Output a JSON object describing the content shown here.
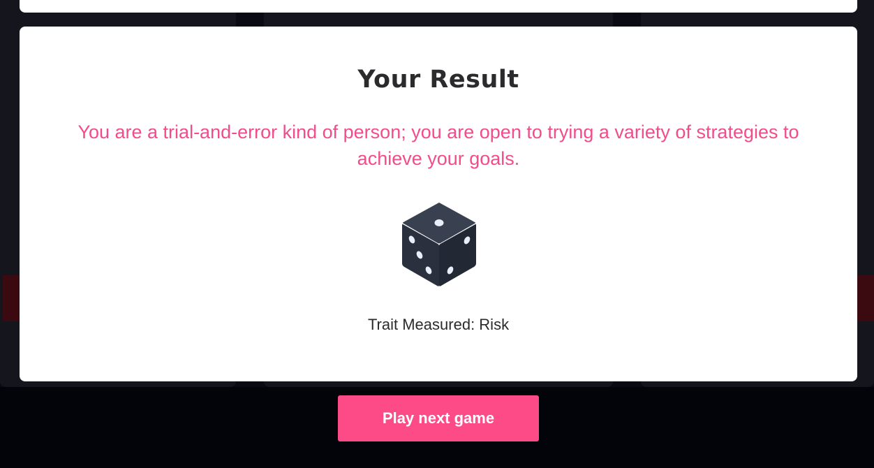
{
  "result": {
    "title": "Your Result",
    "description": "You are a trial-and-error kind of person; you are open to trying a variety of strategies to achieve your goals.",
    "icon": "dice-icon",
    "trait_label": "Trait Measured: Risk"
  },
  "actions": {
    "next_label": "Play next game"
  },
  "colors": {
    "accent": "#fc4b86",
    "description_text": "#f04d8a",
    "heading_text": "#2b2b2e",
    "card_background": "#ffffff",
    "page_background": "#05060c",
    "dice_body": "#2a303d"
  }
}
